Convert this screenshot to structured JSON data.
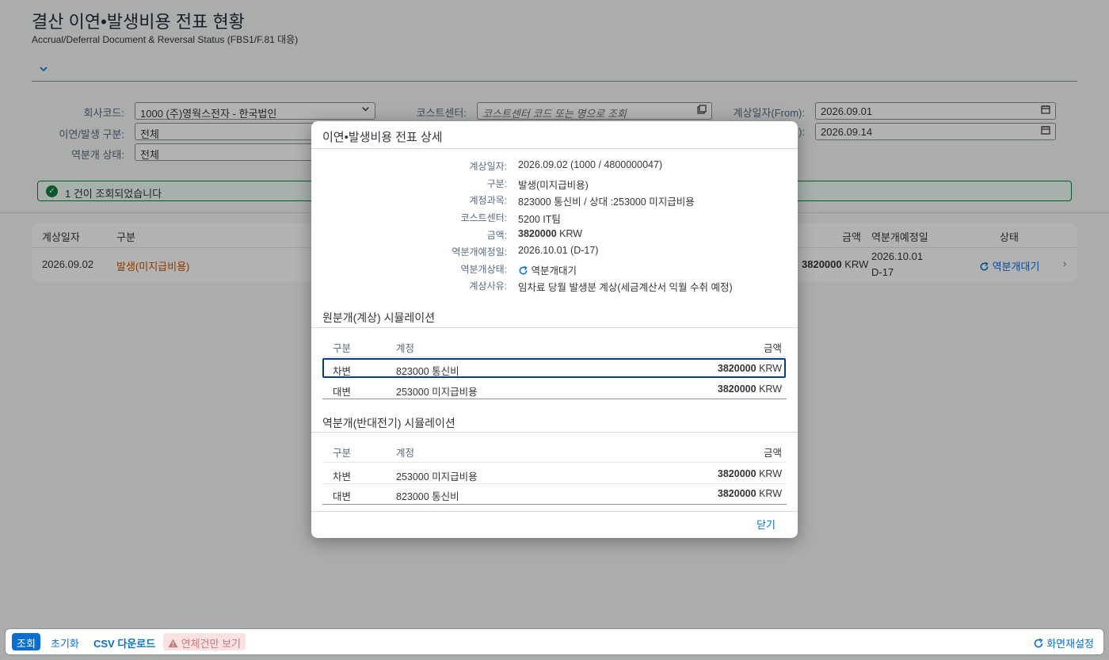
{
  "header": {
    "title": "결산 이연•발생비용 전표 현황",
    "subtitle": "Accrual/Deferral Document & Reversal Status (FBS1/F.81 대응)"
  },
  "filters": {
    "company_label": "회사코드:",
    "company_value": "1000 (주)영웍스전자 - 한국법인",
    "costcenter_label": "코스트센터:",
    "costcenter_placeholder": "코스트센터 코드 또는 명으로 조회",
    "date_from_label": "계상일자(From):",
    "date_from_value": "2026.09.01",
    "type_label": "이연/발생 구분:",
    "type_value": "전체",
    "date_to_label": "):",
    "date_to_value": "2026.09.14",
    "reversal_label": "역분개 상태:",
    "reversal_value": "전체"
  },
  "message": "1 건이 조회되었습니다",
  "table": {
    "columns": [
      "계상일자",
      "구분",
      "금액",
      "역분개예정일",
      "상태"
    ],
    "rows": [
      {
        "date": "2026.09.02",
        "type": "발생(미지급비용)",
        "amount": "3820000",
        "currency": "KRW",
        "reversal_date": "2026.10.01",
        "dday": "D-17",
        "status": "역분개대기"
      }
    ]
  },
  "dialog": {
    "title": "이연•발생비용 전표 상세",
    "details": [
      {
        "label": "계상일자:",
        "value": "2026.09.02 (1000 / 4800000047)"
      },
      {
        "label": "구분:",
        "value": "발생(미지급비용)"
      },
      {
        "label": "계정과목:",
        "value": "823000 통신비 / 상대 :253000 미지급비용"
      },
      {
        "label": "코스트센터:",
        "value": "5200 IT팀"
      },
      {
        "label": "금액:",
        "value": "3820000",
        "currency": "KRW"
      },
      {
        "label": "역분개예정일:",
        "value": "2026.10.01 (D-17)"
      },
      {
        "label": "역분개상태:",
        "value": "역분개대기"
      },
      {
        "label": "계상사유:",
        "value": "임차료 당월 발생분 계상(세금계산서 익월 수취 예정)"
      }
    ],
    "sim1_title": "원분개(계상) 시뮬레이션",
    "sim2_title": "역분개(반대전기) 시뮬레이션",
    "sim_columns": [
      "구분",
      "계정",
      "금액"
    ],
    "sim1_rows": [
      {
        "side": "차변",
        "account": "823000 통신비",
        "amount": "3820000",
        "currency": "KRW"
      },
      {
        "side": "대변",
        "account": "253000 미지급비용",
        "amount": "3820000",
        "currency": "KRW"
      }
    ],
    "sim2_rows": [
      {
        "side": "차변",
        "account": "253000 미지급비용",
        "amount": "3820000",
        "currency": "KRW"
      },
      {
        "side": "대변",
        "account": "823000 통신비",
        "amount": "3820000",
        "currency": "KRW"
      }
    ],
    "close_label": "닫기"
  },
  "footer": {
    "search": "조회",
    "reset": "초기화",
    "csv": "CSV 다운로드",
    "overdue": "연체건만 보기",
    "refresh": "화면재설정"
  },
  "colors": {
    "accent": "#c35500",
    "link": "#0a6ed1",
    "success": "#107e3e"
  }
}
